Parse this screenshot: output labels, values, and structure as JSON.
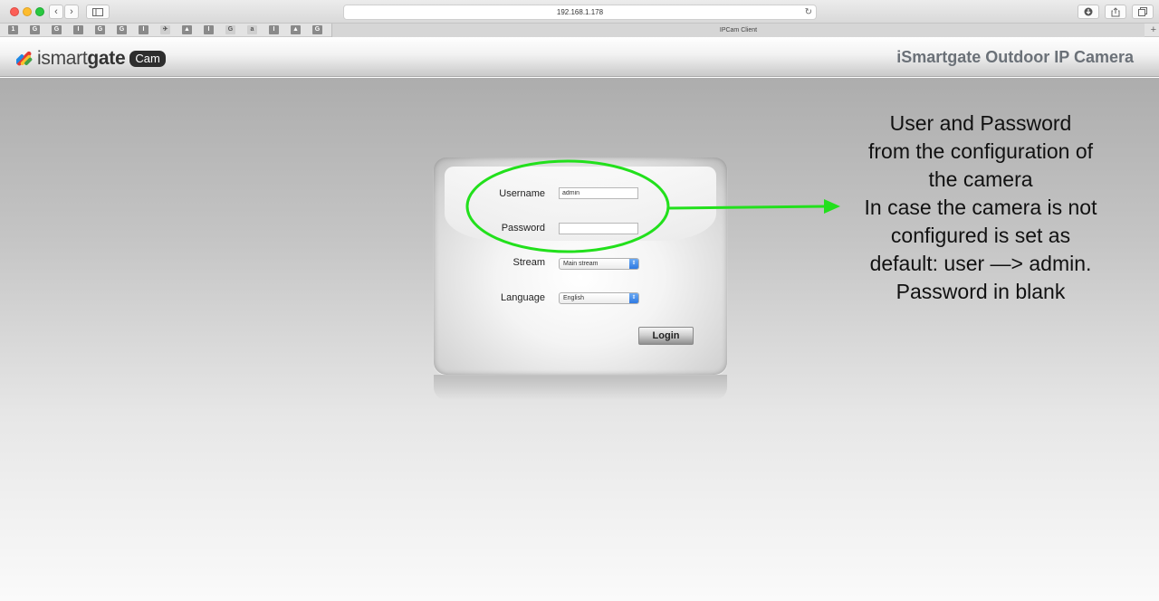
{
  "browser": {
    "url": "192.168.1.178",
    "tab_title": "IPCam Client",
    "nav_back": "‹",
    "nav_forward": "›",
    "new_tab": "+",
    "bookmarks": [
      "1",
      "G",
      "G",
      "I",
      "G",
      "G",
      "I",
      "✈",
      "▲",
      "I",
      "G",
      "a",
      "I",
      "▲",
      "G"
    ]
  },
  "header": {
    "logo_prefix": "ismart",
    "logo_bold": "gate",
    "logo_badge": "Cam",
    "product_title": "iSmartgate Outdoor IP Camera"
  },
  "login": {
    "username_label": "Username",
    "username_value": "admin",
    "password_label": "Password",
    "password_value": "",
    "stream_label": "Stream",
    "stream_value": "Main stream",
    "language_label": "Language",
    "language_value": "English",
    "login_button": "Login"
  },
  "annotation": {
    "color": "#22e01c",
    "lines": [
      "User and Password",
      "from the configuration of",
      "the camera",
      "In case the camera is not",
      "configured is set as",
      "default: user —> admin.",
      "Password in blank"
    ]
  }
}
